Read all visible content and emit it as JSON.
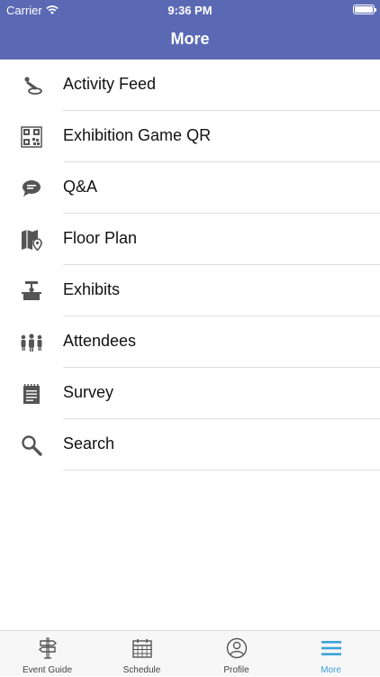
{
  "status": {
    "carrier": "Carrier",
    "time": "9:36 PM"
  },
  "header": {
    "title": "More"
  },
  "menu": [
    {
      "label": "Activity Feed",
      "icon": "activity-feed-icon"
    },
    {
      "label": "Exhibition Game QR",
      "icon": "qr-code-icon"
    },
    {
      "label": "Q&A",
      "icon": "chat-bubble-icon"
    },
    {
      "label": "Floor Plan",
      "icon": "map-pin-icon"
    },
    {
      "label": "Exhibits",
      "icon": "exhibit-booth-icon"
    },
    {
      "label": "Attendees",
      "icon": "people-icon"
    },
    {
      "label": "Survey",
      "icon": "clipboard-icon"
    },
    {
      "label": "Search",
      "icon": "search-icon"
    }
  ],
  "tabs": [
    {
      "label": "Event Guide",
      "icon": "signpost-icon"
    },
    {
      "label": "Schedule",
      "icon": "calendar-icon"
    },
    {
      "label": "Profile",
      "icon": "profile-icon"
    },
    {
      "label": "More",
      "icon": "menu-icon",
      "active": true
    }
  ],
  "colors": {
    "header": "#5b69b5",
    "active_tab": "#3ba3d8",
    "icon": "#555555"
  }
}
